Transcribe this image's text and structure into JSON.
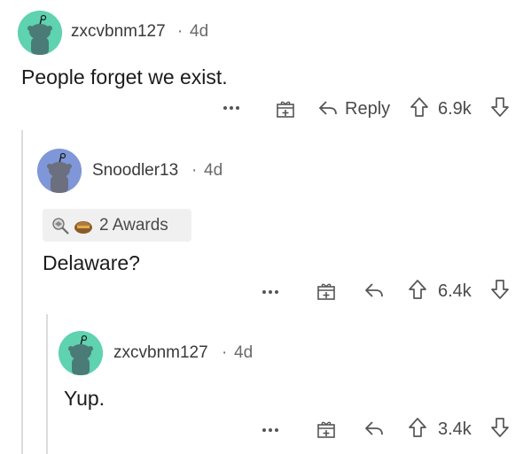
{
  "comments": [
    {
      "username": "zxcvbnm127",
      "separator": "·",
      "age": "4d",
      "body": "People forget we exist.",
      "reply_label": "Reply",
      "score": "6.9k",
      "avatar_color": "#5fd2b0"
    },
    {
      "username": "Snoodler13",
      "separator": "·",
      "age": "4d",
      "awards_label": "2 Awards",
      "body": "Delaware?",
      "score": "6.4k",
      "avatar_color": "#7f97d8"
    },
    {
      "username": "zxcvbnm127",
      "separator": "·",
      "age": "4d",
      "body": "Yup.",
      "score": "3.4k",
      "avatar_color": "#5fd2b0"
    }
  ],
  "icons": {
    "more": "more-options-icon",
    "award": "gift-award-icon",
    "reply": "reply-arrow-icon",
    "upvote": "upvote-arrow-icon",
    "downvote": "downvote-arrow-icon"
  }
}
